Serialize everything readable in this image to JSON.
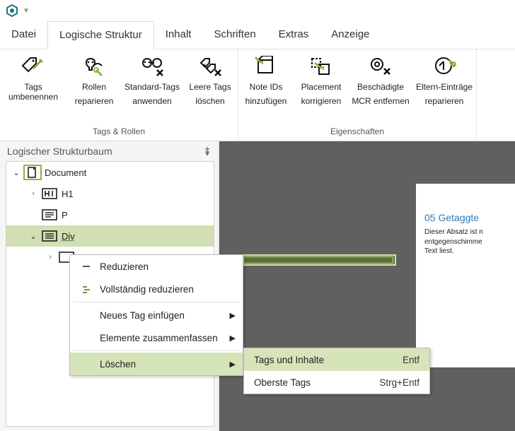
{
  "menus": {
    "datei": "Datei",
    "struktur": "Logische Struktur",
    "inhalt": "Inhalt",
    "schriften": "Schriften",
    "extras": "Extras",
    "anzeige": "Anzeige"
  },
  "ribbon": {
    "g1": {
      "label": "Tags & Rollen",
      "b1a": "Tags umbenennen",
      "b2a": "Rollen",
      "b2b": "reparieren",
      "b3a": "Standard-Tags",
      "b3b": "anwenden",
      "b4a": "Leere Tags",
      "b4b": "löschen"
    },
    "g2": {
      "label": "Eigenschaften",
      "b1a": "Note IDs",
      "b1b": "hinzufügen",
      "b2a": "Placement",
      "b2b": "korrigieren",
      "b3a": "Beschädigte",
      "b3b": "MCR entfernen",
      "b4a": "Eltern-Einträge",
      "b4b": "reparieren"
    }
  },
  "sidebar": {
    "title": "Logischer Strukturbaum"
  },
  "tree": {
    "doc": "Document",
    "h1": "H1",
    "p": "P",
    "div": "Div"
  },
  "ctx": {
    "reduce": "Reduzieren",
    "reduceAll": "Vollständig reduzieren",
    "newTag": "Neues Tag einfügen",
    "merge": "Elemente zusammenfassen",
    "delete": "Löschen"
  },
  "sub": {
    "tagsContent": "Tags und Inhalte",
    "tagsContentSc": "Entf",
    "topTags": "Oberste Tags",
    "topTagsSc": "Strg+Entf"
  },
  "doc": {
    "heading": "05 Getaggte ",
    "para1": "Dieser Absatz ist n",
    "para2": "entgegenschimme",
    "para3": "Text liest."
  }
}
